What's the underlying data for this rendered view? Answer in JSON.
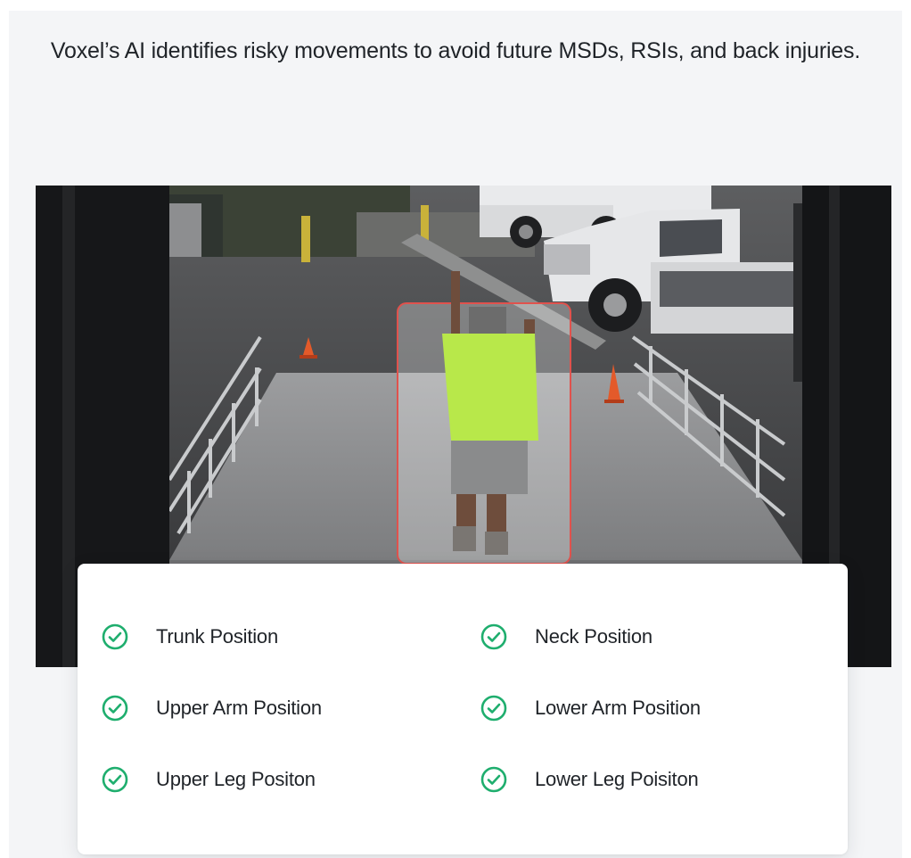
{
  "headline": "Voxel’s AI identifies risky movements to avoid future MSDs, RSIs, and back injuries.",
  "scene": {
    "image": "Security camera frame: worker in a high-visibility yellow shirt carrying a long board overhead up a loading ramp, with white pickup trucks in the background and an AI detection box around the worker"
  },
  "features": [
    {
      "label": "Trunk Position",
      "icon": "check-circle-icon"
    },
    {
      "label": "Neck Position",
      "icon": "check-circle-icon"
    },
    {
      "label": "Upper Arm Position",
      "icon": "check-circle-icon"
    },
    {
      "label": "Lower Arm Position",
      "icon": "check-circle-icon"
    },
    {
      "label": "Upper Leg Positon",
      "icon": "check-circle-icon"
    },
    {
      "label": "Lower Leg Poisiton",
      "icon": "check-circle-icon"
    }
  ],
  "colors": {
    "check": "#1fae6e",
    "detection_box": "#e0524d",
    "shirt": "#b8e84a"
  }
}
